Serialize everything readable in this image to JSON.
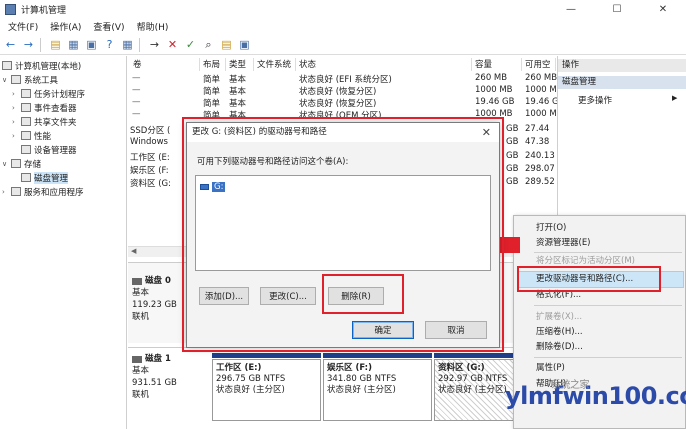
{
  "window": {
    "title": "计算机管理",
    "min": "—",
    "max": "☐",
    "close": "✕"
  },
  "menu": [
    "文件(F)",
    "操作(A)",
    "查看(V)",
    "帮助(H)"
  ],
  "tree": {
    "root": "计算机管理(本地)",
    "system_tools": "系统工具",
    "task_scheduler": "任务计划程序",
    "event_viewer": "事件查看器",
    "shared_folders": "共享文件夹",
    "performance": "性能",
    "device_manager": "设备管理器",
    "storage": "存储",
    "disk_management": "磁盘管理",
    "services": "服务和应用程序"
  },
  "volume_table": {
    "headers": [
      "卷",
      "布局",
      "类型",
      "文件系统",
      "状态",
      "容量",
      "可用空"
    ],
    "rows": [
      [
        "",
        "简单",
        "基本",
        "",
        "状态良好 (EFI 系统分区)",
        "260 MB",
        "260 MB"
      ],
      [
        "",
        "简单",
        "基本",
        "",
        "状态良好 (恢复分区)",
        "1000 MB",
        "1000 MB"
      ],
      [
        "",
        "简单",
        "基本",
        "",
        "状态良好 (恢复分区)",
        "19.46 GB",
        "19.46 GB"
      ],
      [
        "",
        "简单",
        "基本",
        "",
        "状态良好 (OEM 分区)",
        "1000 MB",
        "1000 MB"
      ],
      [
        "SSD分区 (",
        "",
        "",
        "",
        "",
        "GB",
        "27.44"
      ],
      [
        "Windows",
        "",
        "",
        "",
        "",
        "GB",
        "47.38"
      ],
      [
        "工作区 (E:",
        "",
        "",
        "",
        "",
        "GB",
        "240.13"
      ],
      [
        "娱乐区 (F:",
        "",
        "",
        "",
        "",
        "GB",
        "298.07"
      ],
      [
        "资料区 (G:",
        "",
        "",
        "",
        "",
        "GB",
        "289.52"
      ]
    ]
  },
  "disks": {
    "disk0": {
      "name": "磁盘 0",
      "type": "基本",
      "size": "119.23 GB",
      "status": "联机"
    },
    "disk1": {
      "name": "磁盘 1",
      "type": "基本",
      "size": "931.51 GB",
      "status": "联机"
    },
    "partitions": [
      {
        "name": "工作区  (E:)",
        "size": "296.75 GB NTFS",
        "status": "状态良好 (主分区)"
      },
      {
        "name": "娱乐区  (F:)",
        "size": "341.80 GB NTFS",
        "status": "状态良好 (主分区)"
      },
      {
        "name": "资料区  (G:)",
        "size": "292.97 GB NTFS",
        "status": "状态良好 (主分区)"
      }
    ]
  },
  "actions": {
    "header": "操作",
    "section": "磁盘管理",
    "more": "更多操作"
  },
  "dialog": {
    "title": "更改 G: (资料区) 的驱动器号和路径",
    "prompt": "可用下列驱动器号和路径访问这个卷(A):",
    "item": "G:",
    "add": "添加(D)...",
    "change": "更改(C)...",
    "remove": "删除(R)",
    "ok": "确定",
    "cancel": "取消",
    "close": "✕"
  },
  "context_menu": {
    "items": [
      {
        "label": "打开(O)",
        "disabled": false
      },
      {
        "label": "资源管理器(E)",
        "disabled": false
      },
      {
        "label": "将分区标记为活动分区(M)",
        "disabled": true
      },
      {
        "label": "更改驱动器号和路径(C)...",
        "disabled": false,
        "highlighted": true
      },
      {
        "label": "格式化(F)...",
        "disabled": false
      },
      {
        "label": "扩展卷(X)...",
        "disabled": true
      },
      {
        "label": "压缩卷(H)...",
        "disabled": false
      },
      {
        "label": "删除卷(D)...",
        "disabled": false
      },
      {
        "label": "属性(P)",
        "disabled": false
      },
      {
        "label": "帮助(H)",
        "disabled": false
      }
    ]
  },
  "watermark": {
    "text": "ylmfwin100.com",
    "brand": "系统之家"
  },
  "colors": {
    "annotation_red": "#e0202a",
    "selection_blue": "#cce4f7",
    "disk_bar": "#1f3f8a"
  }
}
